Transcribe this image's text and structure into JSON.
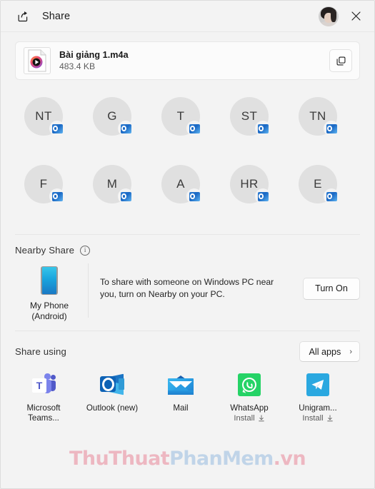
{
  "window": {
    "title": "Share",
    "share_icon": "share-icon",
    "close_icon": "close-icon",
    "account_avatar": "account-avatar"
  },
  "file": {
    "name": "Bài giảng 1.m4a",
    "size": "483.4 KB",
    "thumb_icon": "audio-file-icon",
    "copy_icon": "copy-icon"
  },
  "contacts": {
    "rows": [
      [
        {
          "initials": "NT",
          "name": "",
          "badge": "outlook-badge"
        },
        {
          "initials": "G",
          "name": "",
          "badge": "outlook-badge"
        },
        {
          "initials": "T",
          "name": "",
          "badge": "outlook-badge"
        },
        {
          "initials": "ST",
          "name": "",
          "badge": "outlook-badge"
        },
        {
          "initials": "TN",
          "name": "",
          "badge": "outlook-badge"
        }
      ],
      [
        {
          "initials": "F",
          "name": "",
          "badge": "outlook-badge"
        },
        {
          "initials": "M",
          "name": "",
          "badge": "outlook-badge"
        },
        {
          "initials": "A",
          "name": "",
          "badge": "outlook-badge"
        },
        {
          "initials": "HR",
          "name": "",
          "badge": "outlook-badge"
        },
        {
          "initials": "E",
          "name": "",
          "badge": "outlook-badge"
        }
      ]
    ]
  },
  "nearby_share": {
    "title": "Nearby Share",
    "info_glyph": "i",
    "device": {
      "label_line1": "My Phone",
      "label_line2": "(Android)",
      "icon": "phone-icon"
    },
    "message_line1": "To share with someone on Windows PC near you,",
    "message_line2": "turn on Nearby on your PC.",
    "turn_on_label": "Turn On"
  },
  "share_using": {
    "title": "Share using",
    "all_apps_label": "All apps",
    "all_apps_chevron": "›",
    "apps": [
      {
        "label": "Microsoft Teams...",
        "install": "",
        "icon": "microsoft-teams-icon"
      },
      {
        "label": "Outlook (new)",
        "install": "",
        "icon": "outlook-icon"
      },
      {
        "label": "Mail",
        "install": "",
        "icon": "mail-icon"
      },
      {
        "label": "WhatsApp",
        "install": "Install",
        "icon": "whatsapp-icon"
      },
      {
        "label": "Unigram...",
        "install": "Install",
        "icon": "telegram-icon"
      }
    ]
  },
  "watermark": {
    "part1": "ThuThuat",
    "part2": "PhanMem",
    "part3": ".vn"
  }
}
